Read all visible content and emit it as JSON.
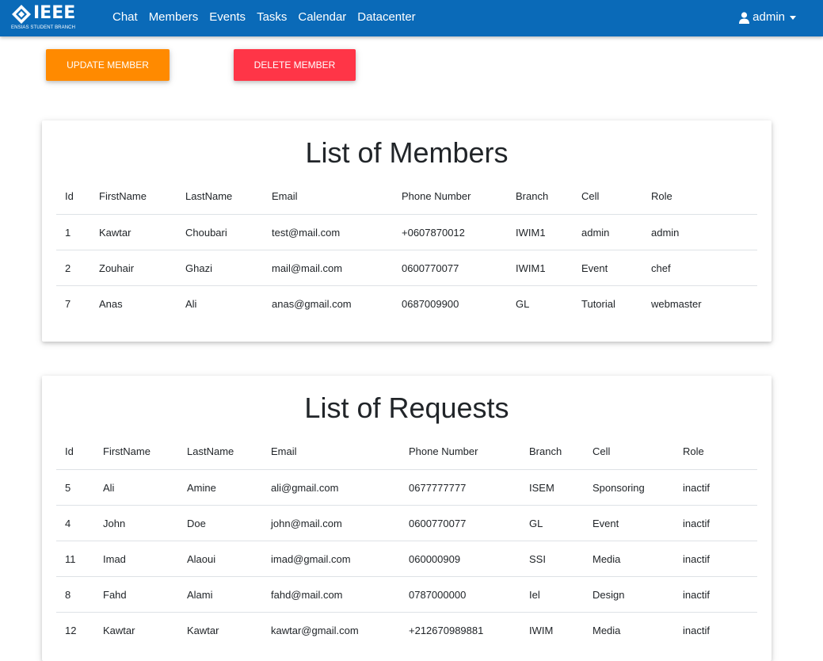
{
  "nav": {
    "logo_text": "IEEE",
    "logo_sub": "ENSIAS STUDENT BRANCH",
    "links": [
      "Chat",
      "Members",
      "Events",
      "Tasks",
      "Calendar",
      "Datacenter"
    ],
    "user": "admin"
  },
  "actions": {
    "update_label": "UPDATE MEMBER",
    "delete_label": "DELETE MEMBER"
  },
  "members": {
    "title": "List of Members",
    "headers": [
      "Id",
      "FirstName",
      "LastName",
      "Email",
      "Phone Number",
      "Branch",
      "Cell",
      "Role"
    ],
    "rows": [
      [
        "1",
        "Kawtar",
        "Choubari",
        "test@mail.com",
        "+0607870012",
        "IWIM1",
        "admin",
        "admin"
      ],
      [
        "2",
        "Zouhair",
        "Ghazi",
        "mail@mail.com",
        "0600770077",
        "IWIM1",
        "Event",
        "chef"
      ],
      [
        "7",
        "Anas",
        "Ali",
        "anas@gmail.com",
        "0687009900",
        "GL",
        "Tutorial",
        "webmaster"
      ]
    ]
  },
  "requests": {
    "title": "List of Requests",
    "headers": [
      "Id",
      "FirstName",
      "LastName",
      "Email",
      "Phone Number",
      "Branch",
      "Cell",
      "Role"
    ],
    "rows": [
      [
        "5",
        "Ali",
        "Amine",
        "ali@gmail.com",
        "0677777777",
        "ISEM",
        "Sponsoring",
        "inactif"
      ],
      [
        "4",
        "John",
        "Doe",
        "john@mail.com",
        "0600770077",
        "GL",
        "Event",
        "inactif"
      ],
      [
        "11",
        "Imad",
        "Alaoui",
        "imad@gmail.com",
        "060000909",
        "SSI",
        "Media",
        "inactif"
      ],
      [
        "8",
        "Fahd",
        "Alami",
        "fahd@mail.com",
        "0787000000",
        "Iel",
        "Design",
        "inactif"
      ],
      [
        "12",
        "Kawtar",
        "Kawtar",
        "kawtar@gmail.com",
        "+212670989881",
        "IWIM",
        "Media",
        "inactif"
      ]
    ]
  },
  "colors": {
    "navbar": "#0a6ab8",
    "update_button": "#ff8a00",
    "delete_button": "#ff3547"
  }
}
